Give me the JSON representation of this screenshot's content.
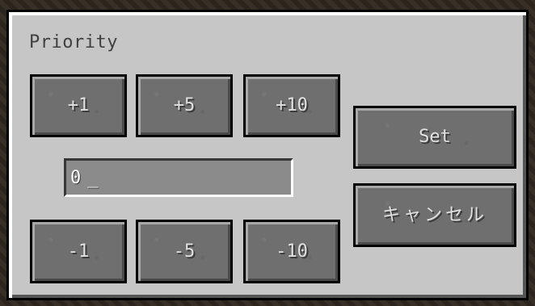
{
  "dialog": {
    "title": "Priority",
    "increment_buttons": [
      "+1",
      "+5",
      "+10"
    ],
    "decrement_buttons": [
      "-1",
      "-5",
      "-10"
    ],
    "priority_value": "0",
    "cursor": "_",
    "set_label": "Set",
    "cancel_label": "キャンセル"
  },
  "colors": {
    "panel": "#c6c6c6",
    "button": "#6f6f6f",
    "field": "#8b8b8b",
    "title_text": "#404040",
    "button_text": "#e0e0e0"
  }
}
